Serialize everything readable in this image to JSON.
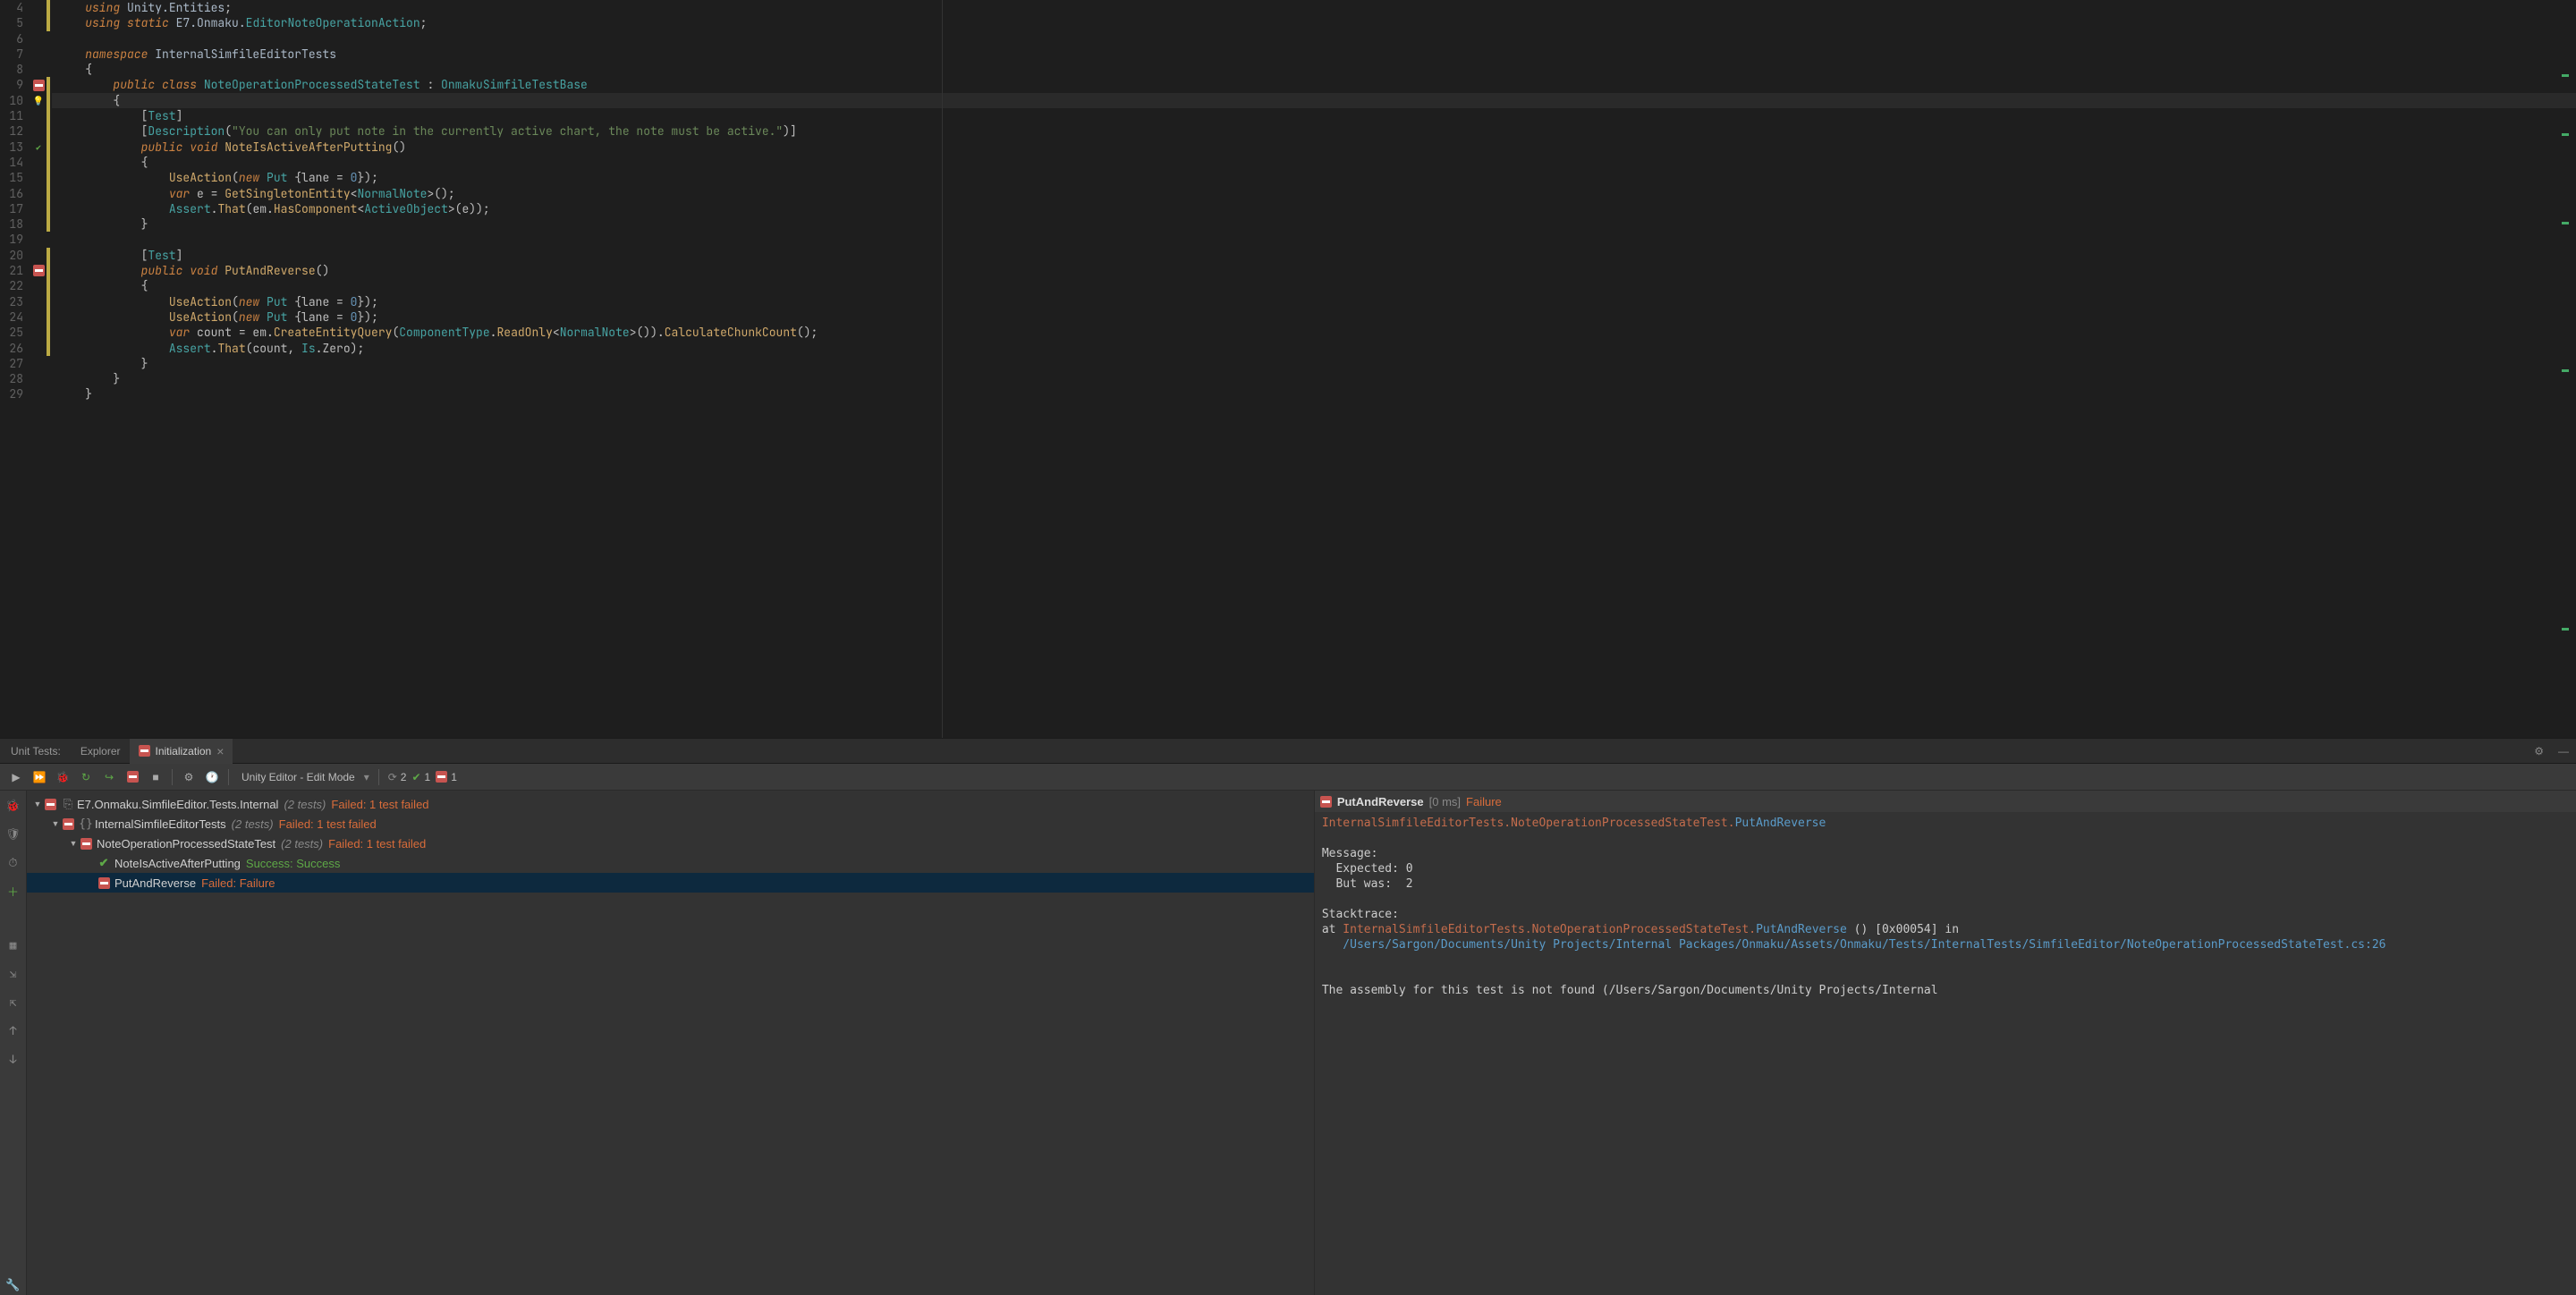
{
  "editor": {
    "lines": [
      4,
      5,
      6,
      7,
      8,
      9,
      10,
      11,
      12,
      13,
      14,
      15,
      16,
      17,
      18,
      19,
      20,
      21,
      22,
      23,
      24,
      25,
      26,
      27,
      28,
      29
    ]
  },
  "panel": {
    "label": "Unit Tests:",
    "explorer": "Explorer",
    "active_tab": "Initialization",
    "dropdown": "Unity Editor - Edit Mode",
    "count_total": "2",
    "count_pass": "1",
    "count_fail": "1"
  },
  "tree": {
    "root_name": "E7.Onmaku.SimfileEditor.Tests.Internal",
    "root_meta": "(2 tests)",
    "root_result": "Failed: 1 test failed",
    "ns_name": "InternalSimfileEditorTests",
    "ns_meta": "(2 tests)",
    "ns_result": "Failed: 1 test failed",
    "class_name": "NoteOperationProcessedStateTest",
    "class_meta": "(2 tests)",
    "class_result": "Failed: 1 test failed",
    "test1_name": "NoteIsActiveAfterPutting",
    "test1_result": "Success: Success",
    "test2_name": "PutAndReverse",
    "test2_result": "Failed: Failure"
  },
  "detail": {
    "title": "PutAndReverse",
    "time": "[0 ms]",
    "status": "Failure",
    "qualified_ns": "InternalSimfileEditorTests.NoteOperationProcessedStateTest.",
    "qualified_method": "PutAndReverse",
    "msg_label": "Message:",
    "msg_l1": "  Expected: 0",
    "msg_l2": "  But was:  2",
    "stack_label": "Stacktrace:",
    "stack_prefix": "at ",
    "stack_ns": "InternalSimfileEditorTests.NoteOperationProcessedStateTest.",
    "stack_method": "PutAndReverse",
    "stack_suffix": " () [0x00054] in ",
    "stack_path": "/Users/Sargon/Documents/Unity Projects/Internal Packages/Onmaku/Assets/Onmaku/Tests/InternalTests/SimfileEditor/NoteOperationProcessedStateTest.cs:26",
    "assembly_note": "The assembly for this test is not found (/Users/Sargon/Documents/Unity Projects/Internal"
  }
}
